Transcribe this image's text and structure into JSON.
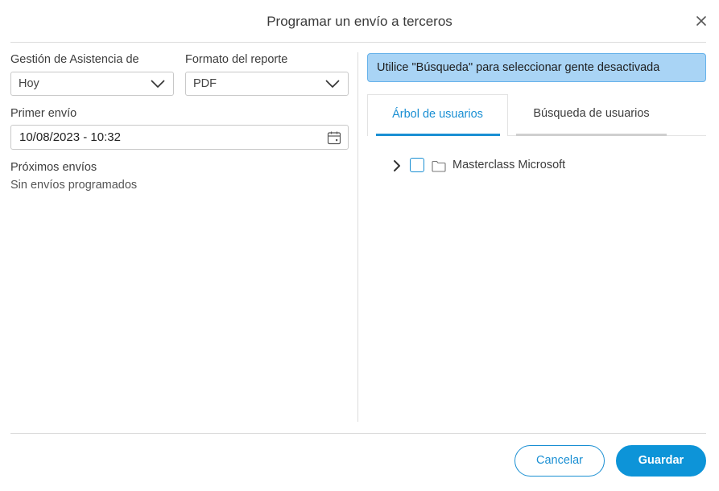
{
  "dialog": {
    "title": "Programar un envío a terceros",
    "close_icon": "close-icon"
  },
  "left": {
    "gestion_label": "Gestión de Asistencia de",
    "gestion_value": "Hoy",
    "formato_label": "Formato del reporte",
    "formato_value": "PDF",
    "primer_envio_label": "Primer envío",
    "primer_envio_value": "10/08/2023 - 10:32",
    "proximos_label": "Próximos envíos",
    "proximos_value": "Sin envíos programados"
  },
  "right": {
    "info_text": "Utilice \"Búsqueda\" para seleccionar gente desactivada",
    "tabs": [
      {
        "label": "Árbol de usuarios",
        "active": true
      },
      {
        "label": "Búsqueda de usuarios",
        "active": false
      }
    ],
    "tree": [
      {
        "label": "Masterclass Microsoft",
        "checked": false,
        "expanded": false
      }
    ]
  },
  "footer": {
    "cancel_label": "Cancelar",
    "save_label": "Guardar"
  },
  "colors": {
    "accent": "#1a8fd3",
    "primary_button": "#0d94d8",
    "info_background": "#a9d4f5",
    "info_border": "#66b2ea"
  }
}
